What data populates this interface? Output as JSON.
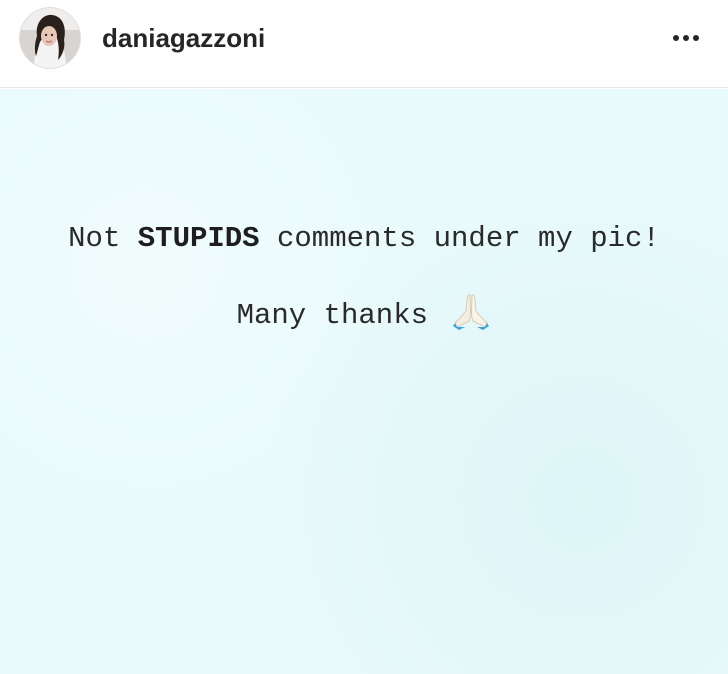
{
  "header": {
    "username": "daniagazzoni",
    "avatar_icon": "profile-photo",
    "more_icon": "more-horizontal-icon"
  },
  "image": {
    "background_color": "#e9fafb",
    "line1": {
      "before": "Not ",
      "bold": "STUPIDS",
      "after": " comments under my pic!"
    },
    "line2": {
      "text": "Many thanks ",
      "emoji_icon": "folded-hands-icon"
    }
  }
}
